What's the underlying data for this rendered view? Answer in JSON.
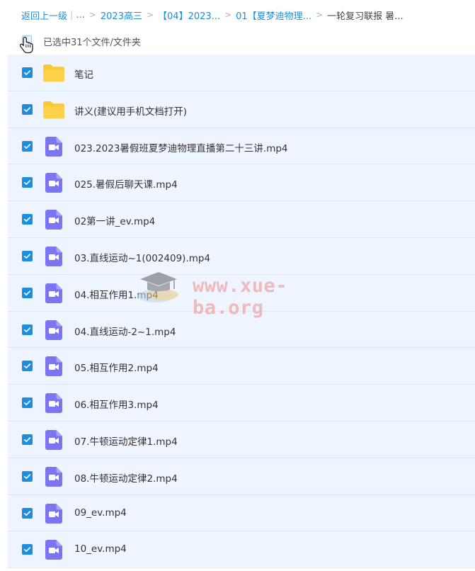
{
  "breadcrumb": {
    "back": "返回上一级",
    "ellipsis": "...",
    "items": [
      "2023高三",
      "【04】2023...",
      "01【夏梦迪物理..."
    ],
    "current": "一轮复习联报 暑..."
  },
  "selection": {
    "text": "已选中31个文件/文件夹"
  },
  "files": [
    {
      "name": "笔记",
      "type": "folder"
    },
    {
      "name": "讲义(建议用手机文档打开)",
      "type": "folder"
    },
    {
      "name": "023.2023暑假班夏梦迪物理直播第二十三讲.mp4",
      "type": "video"
    },
    {
      "name": "025.暑假后聊天课.mp4",
      "type": "video"
    },
    {
      "name": "02第一讲_ev.mp4",
      "type": "video"
    },
    {
      "name": "03.直线运动~1(002409).mp4",
      "type": "video"
    },
    {
      "name": "04.相互作用1.mp4",
      "type": "video"
    },
    {
      "name": "04.直线运动-2~1.mp4",
      "type": "video"
    },
    {
      "name": "05.相互作用2.mp4",
      "type": "video"
    },
    {
      "name": "06.相互作用3.mp4",
      "type": "video"
    },
    {
      "name": "07.牛顿运动定律1.mp4",
      "type": "video"
    },
    {
      "name": "08.牛顿运动定律2.mp4",
      "type": "video"
    },
    {
      "name": "09_ev.mp4",
      "type": "video"
    },
    {
      "name": "10_ev.mp4",
      "type": "video"
    }
  ],
  "watermark": {
    "text": "www.xue-ba.org"
  },
  "colors": {
    "accent": "#1a8fe0",
    "row_bg": "#eef5fe",
    "folder": "#fbc82f",
    "video": "#7c74f0"
  },
  "icons": {
    "folder": "folder-icon",
    "video": "video-file-icon",
    "check": "check-icon",
    "cursor": "hand-cursor-icon",
    "watermark_logo": "graduation-cap-icon"
  }
}
